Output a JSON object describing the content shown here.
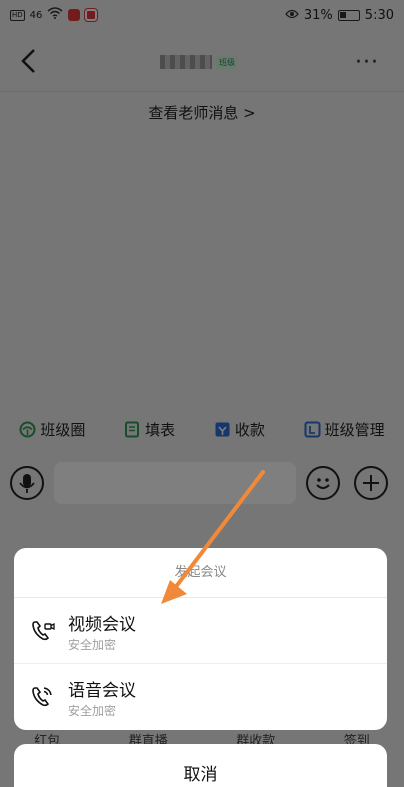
{
  "status_bar": {
    "left_badge": "HD",
    "signal": "46",
    "battery_percent": "31%",
    "time": "5:30"
  },
  "header": {
    "class_tag": "班级",
    "more_label": "···"
  },
  "teacher_link": "查看老师消息 >",
  "quick_actions": [
    {
      "label": "班级圈",
      "icon": "class-circle-icon",
      "color": "#2e9b55"
    },
    {
      "label": "填表",
      "icon": "form-icon",
      "color": "#2e9b55"
    },
    {
      "label": "收款",
      "icon": "payment-icon",
      "color": "#2f6fd6"
    },
    {
      "label": "班级管理",
      "icon": "class-manage-icon",
      "color": "#2f6fd6"
    }
  ],
  "panel_labels": [
    "红包",
    "群直播",
    "群收款",
    "签到"
  ],
  "action_sheet": {
    "title": "发起会议",
    "options": [
      {
        "label": "视频会议",
        "sub": "安全加密",
        "icon": "video-call-icon"
      },
      {
        "label": "语音会议",
        "sub": "安全加密",
        "icon": "voice-call-icon"
      }
    ],
    "cancel": "取消"
  },
  "accent_colors": {
    "arrow": "#f08a3a",
    "class_tag": "#1a9a4a"
  }
}
